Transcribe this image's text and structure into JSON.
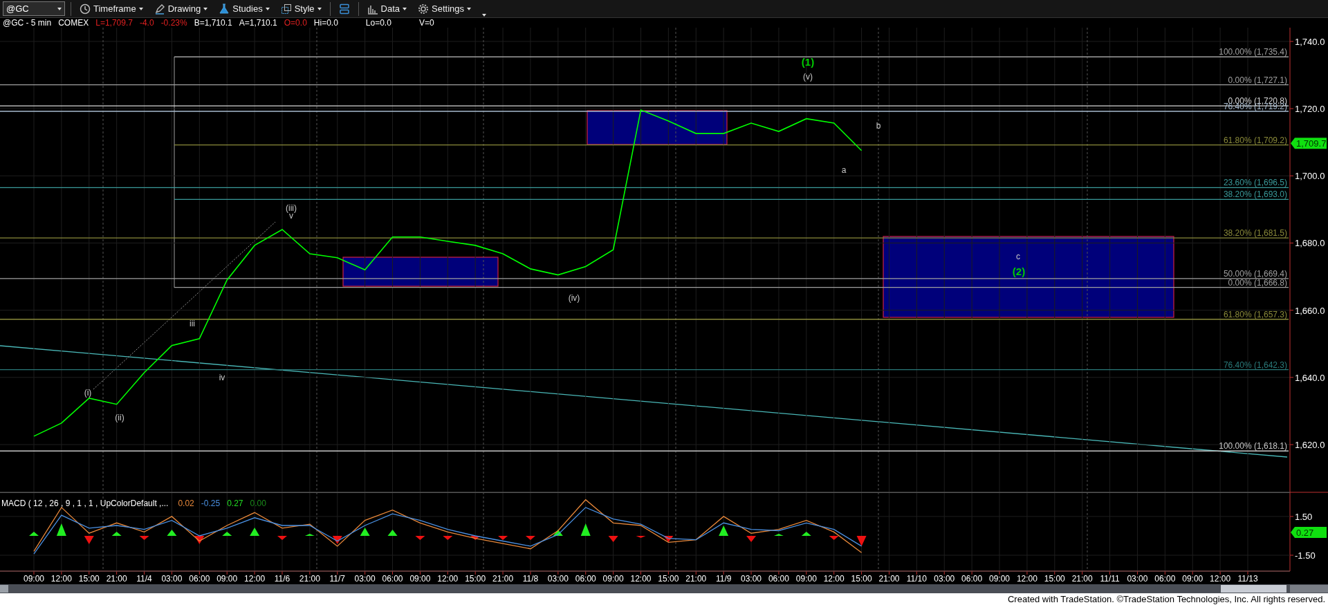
{
  "toolbar": {
    "symbol": "@GC",
    "menus": [
      {
        "label": "Timeframe"
      },
      {
        "label": "Drawing"
      },
      {
        "label": "Studies"
      },
      {
        "label": "Style"
      }
    ],
    "menus_right": [
      {
        "label": "Data"
      },
      {
        "label": "Settings"
      }
    ]
  },
  "quote_line": [
    {
      "text": "@GC - 5 min",
      "color": "#ffffff"
    },
    {
      "text": "COMEX",
      "color": "#ffffff"
    },
    {
      "text": "L=1,709.7",
      "color": "#e02020"
    },
    {
      "text": "-4.0",
      "color": "#e02020"
    },
    {
      "text": "-0.23%",
      "color": "#e02020"
    },
    {
      "text": "B=1,710.1",
      "color": "#ffffff"
    },
    {
      "text": "A=1,710.1",
      "color": "#ffffff"
    },
    {
      "text": "O=0.0",
      "color": "#e02020"
    },
    {
      "text": "Hi=0.0",
      "color": "#ffffff"
    },
    {
      "text": "Lo=0.0",
      "color": "#ffffff"
    },
    {
      "text": "V=0",
      "color": "#ffffff"
    }
  ],
  "price_chart": {
    "last_price": "1,709.7",
    "chart_data": {
      "type": "line",
      "grid": true,
      "categories": [
        "09:00",
        "12:00",
        "15:00",
        "21:00",
        "11/4",
        "03:00",
        "06:00",
        "09:00",
        "12:00",
        "11/6",
        "21:00",
        "11/7",
        "03:00",
        "06:00",
        "09:00",
        "12:00",
        "15:00",
        "21:00",
        "11/8",
        "03:00",
        "06:00",
        "09:00",
        "12:00",
        "15:00",
        "21:00",
        "11/9",
        "03:00",
        "06:00",
        "09:00",
        "12:00",
        "15:00",
        "21:00",
        "11/10",
        "03:00",
        "06:00",
        "09:00",
        "12:00",
        "15:00",
        "21:00",
        "11/11",
        "03:00",
        "06:00",
        "09:00",
        "12:00",
        "11/13"
      ],
      "series": [
        {
          "color": "#00ff00",
          "values": [
            1622.5,
            1626.4,
            1633.8,
            1632,
            1641.4,
            1649.5,
            1651.5,
            1669,
            1679.3,
            1684,
            1676.8,
            1675.6,
            1672,
            1681.8,
            1681.8,
            1680.5,
            1679.3,
            1676.8,
            1672.3,
            1670.5,
            1673,
            1678,
            1719.6,
            1716.3,
            1712.6,
            1712.6,
            1715.7,
            1713.2,
            1717,
            1715.7,
            1707.5,
            null,
            null,
            null,
            null,
            null,
            null,
            null,
            null,
            null,
            null,
            null,
            null,
            null,
            null
          ]
        }
      ],
      "ylim": [
        1605.8,
        1744.1
      ],
      "yticks": [
        {
          "value": 1740,
          "label": "1,740.0"
        },
        {
          "value": 1720,
          "label": "1,720.0"
        },
        {
          "value": 1700,
          "label": "1,700.0"
        },
        {
          "value": 1680,
          "label": "1,680.0"
        },
        {
          "value": 1660,
          "label": "1,660.0"
        },
        {
          "value": 1640,
          "label": "1,640.0"
        },
        {
          "value": 1620,
          "label": "1,620.0"
        }
      ],
      "ref_lines": [
        {
          "axis": "y",
          "value": 1735.4,
          "label": "100.00% (1,735.4)",
          "color": "#a0a0a0"
        },
        {
          "axis": "y",
          "value": 1727.1,
          "label": "0.00% (1,727.1)",
          "color": "#a0a0a0"
        },
        {
          "axis": "y",
          "value": 1720.8,
          "label": "0.00% (1,720.8)",
          "color": "#d8d8d8"
        },
        {
          "axis": "y",
          "value": 1719.2,
          "label": "76.40% (1,719.2)",
          "color": "#a8bcd0"
        },
        {
          "axis": "y",
          "value": 1709.2,
          "label": "61.80% (1,709.2)",
          "color": "#8a8a3a"
        },
        {
          "axis": "y",
          "value": 1696.5,
          "label": "23.60% (1,696.5)",
          "color": "#3a9a9a"
        },
        {
          "axis": "y",
          "value": 1693.0,
          "label": "38.20% (1,693.0)",
          "color": "#3a9a9a"
        },
        {
          "axis": "y",
          "value": 1681.5,
          "label": "38.20% (1,681.5)",
          "color": "#8a8a3a"
        },
        {
          "axis": "y",
          "value": 1669.4,
          "label": "50.00% (1,669.4)",
          "color": "#a0a0a0"
        },
        {
          "axis": "y",
          "value": 1666.8,
          "label": "0.00% (1,666.8)",
          "color": "#a0a0a0"
        },
        {
          "axis": "y",
          "value": 1657.3,
          "label": "61.80% (1,657.3)",
          "color": "#8a8a3a"
        },
        {
          "axis": "y",
          "value": 1642.3,
          "label": "76.40% (1,642.3)",
          "color": "#2a7a7a"
        },
        {
          "axis": "y",
          "value": 1618.1,
          "label": "100.00% (1,618.1)",
          "color": "#c8c8c8"
        }
      ],
      "annotations": [
        "(1)",
        "(v)",
        "b",
        "a",
        "c",
        "(2)",
        "(iii)",
        "v",
        "(iv)",
        "(i)",
        "(ii)",
        "iii",
        "iv"
      ]
    }
  },
  "macd_panel": {
    "title": "MACD ( 12 , 26 , 9 , 1 , 1 , UpColorDefault ,...",
    "readings": [
      {
        "text": "0.02",
        "color": "#e8883a"
      },
      {
        "text": "-0.25",
        "color": "#4a90e2"
      },
      {
        "text": "0.27",
        "color": "#22dd22"
      },
      {
        "text": "0.00",
        "color": "#1a8a1a"
      }
    ],
    "last_value": "0.27",
    "chart_data": {
      "type": "line",
      "grid": true,
      "series": [
        {
          "color": "#e8883a",
          "values": [
            -1.2,
            2.2,
            0.2,
            1.0,
            0.3,
            1.5,
            -0.4,
            0.8,
            1.8,
            0.6,
            0.9,
            -0.8,
            1.2,
            2.0,
            1.0,
            0.3,
            -0.2,
            -0.6,
            -1.0,
            0.4,
            2.8,
            1.0,
            0.8,
            -0.5,
            -0.3,
            1.5,
            0.2,
            0.5,
            1.2,
            0.3,
            -1.3
          ]
        },
        {
          "color": "#4a90e2",
          "values": [
            -1.4,
            1.6,
            0.6,
            0.8,
            0.5,
            1.2,
            0.0,
            0.6,
            1.4,
            0.8,
            0.8,
            -0.4,
            0.8,
            1.7,
            1.2,
            0.5,
            0.0,
            -0.4,
            -0.8,
            0.1,
            2.2,
            1.3,
            0.9,
            -0.2,
            -0.3,
            1.0,
            0.5,
            0.4,
            1.0,
            0.5,
            -0.8
          ]
        }
      ],
      "ylim": [
        -2.73,
        3.37
      ],
      "yticks": [
        {
          "value": 1.5,
          "label": "1.50"
        },
        {
          "value": -1.5,
          "label": "-1.50"
        }
      ]
    }
  },
  "footer": "Created with TradeStation. ©TradeStation Technologies, Inc. All rights reserved."
}
